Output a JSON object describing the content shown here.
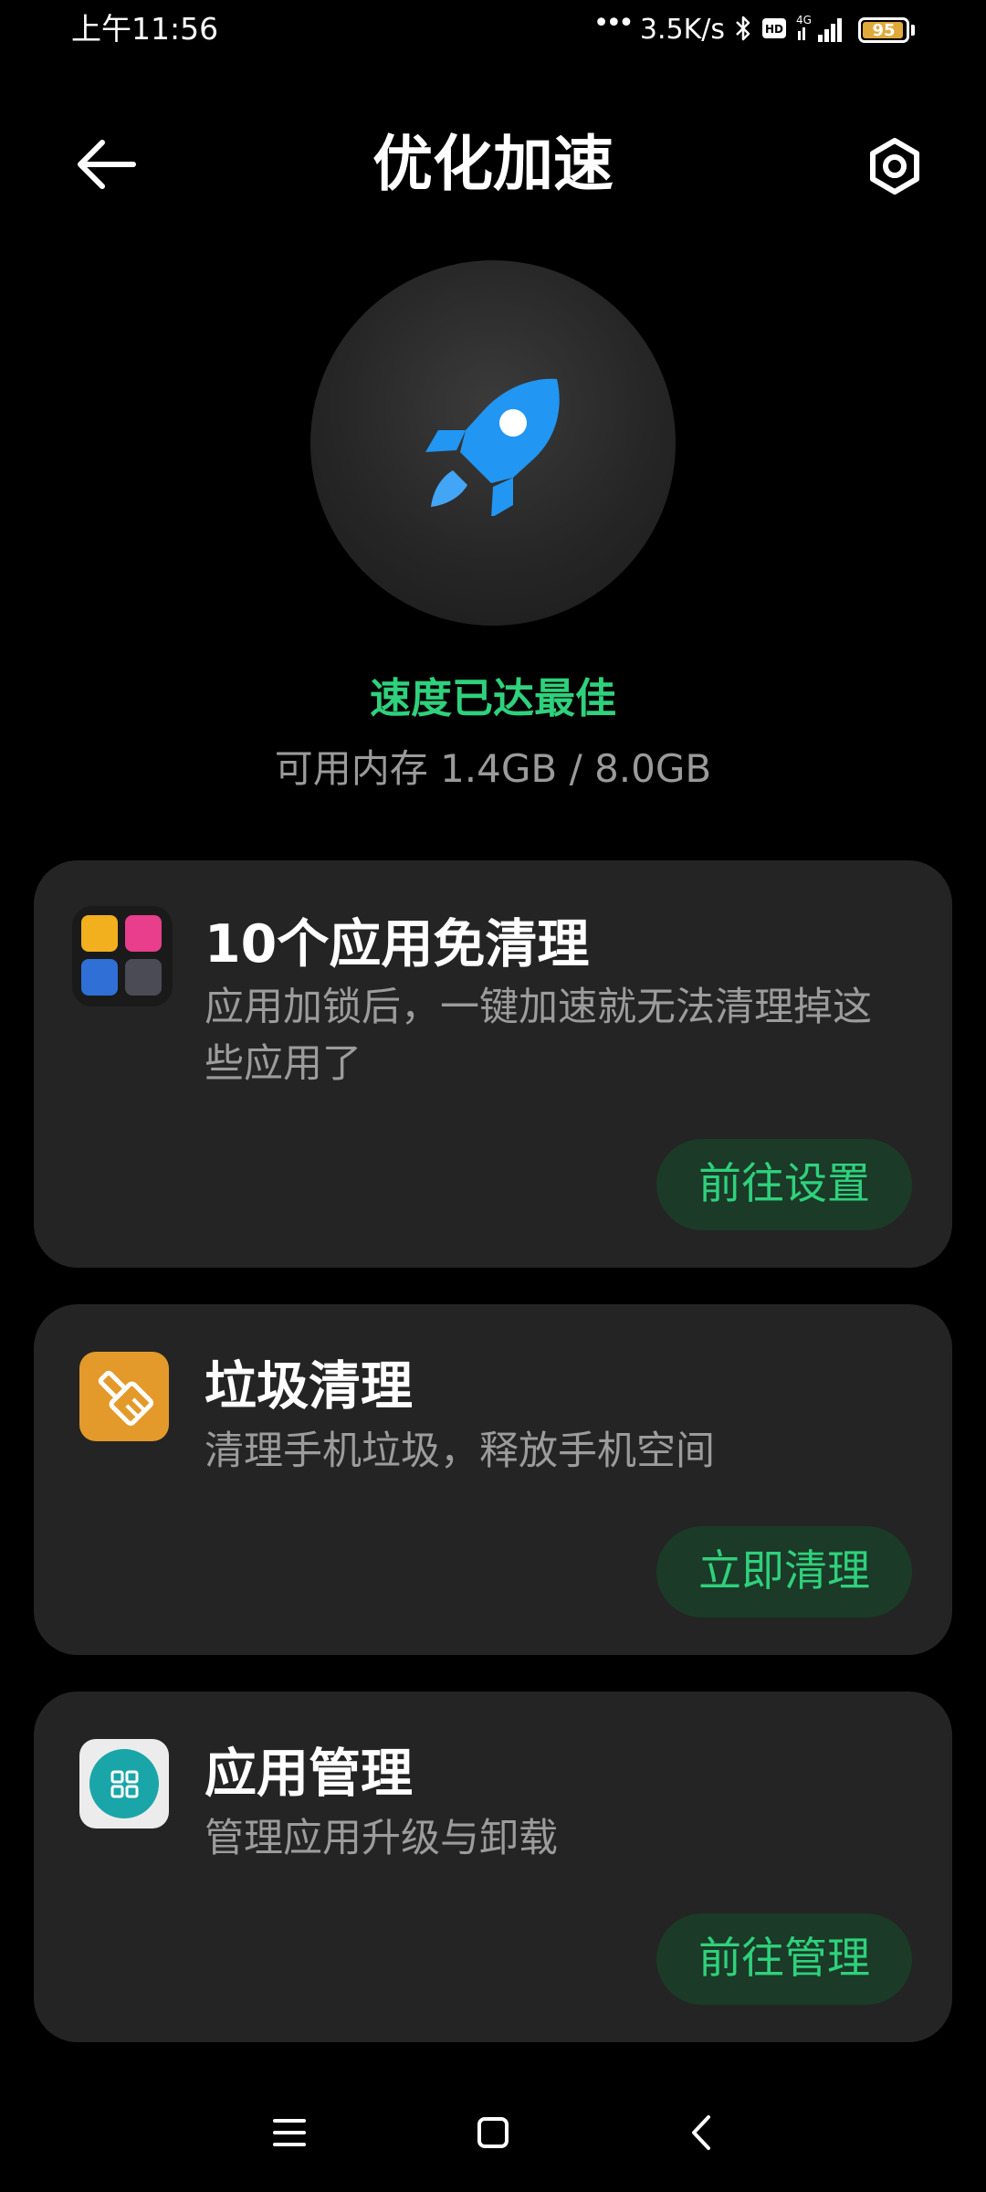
{
  "status_bar": {
    "time": "上午11:56",
    "net_speed": "3.5K/s",
    "network_type": "4G",
    "battery_level": "95",
    "battery_fraction": 0.95,
    "icons": [
      "more-dots-icon",
      "bluetooth-icon",
      "hd-icon",
      "signal-icon",
      "battery-icon"
    ]
  },
  "header": {
    "title": "优化加速",
    "back_icon": "back-arrow-icon",
    "settings_icon": "settings-gear-icon"
  },
  "hero": {
    "icon": "rocket-icon",
    "status": "速度已达最佳",
    "memory_label": "可用内存 1.4GB / 8.0GB"
  },
  "cards": [
    {
      "icon": "locked-apps-grid-icon",
      "title": "10个应用免清理",
      "description": "应用加锁后，一键加速就无法清理掉这些应用了",
      "button": "前往设置"
    },
    {
      "icon": "cleaner-brush-icon",
      "title": "垃圾清理",
      "description": "清理手机垃圾，释放手机空间",
      "button": "立即清理"
    },
    {
      "icon": "app-manager-icon",
      "title": "应用管理",
      "description": "管理应用升级与卸载",
      "button": "前往管理"
    }
  ],
  "colors": {
    "accent_green": "#2fd17c",
    "button_bg": "#1b3a27",
    "card_bg": "#242424",
    "rocket_blue": "#2196f3",
    "cleaner_orange": "#e39a2a",
    "manager_teal": "#1aa5a8"
  },
  "nav_bar": {
    "icons": [
      "menu-icon",
      "home-icon",
      "back-icon"
    ]
  }
}
